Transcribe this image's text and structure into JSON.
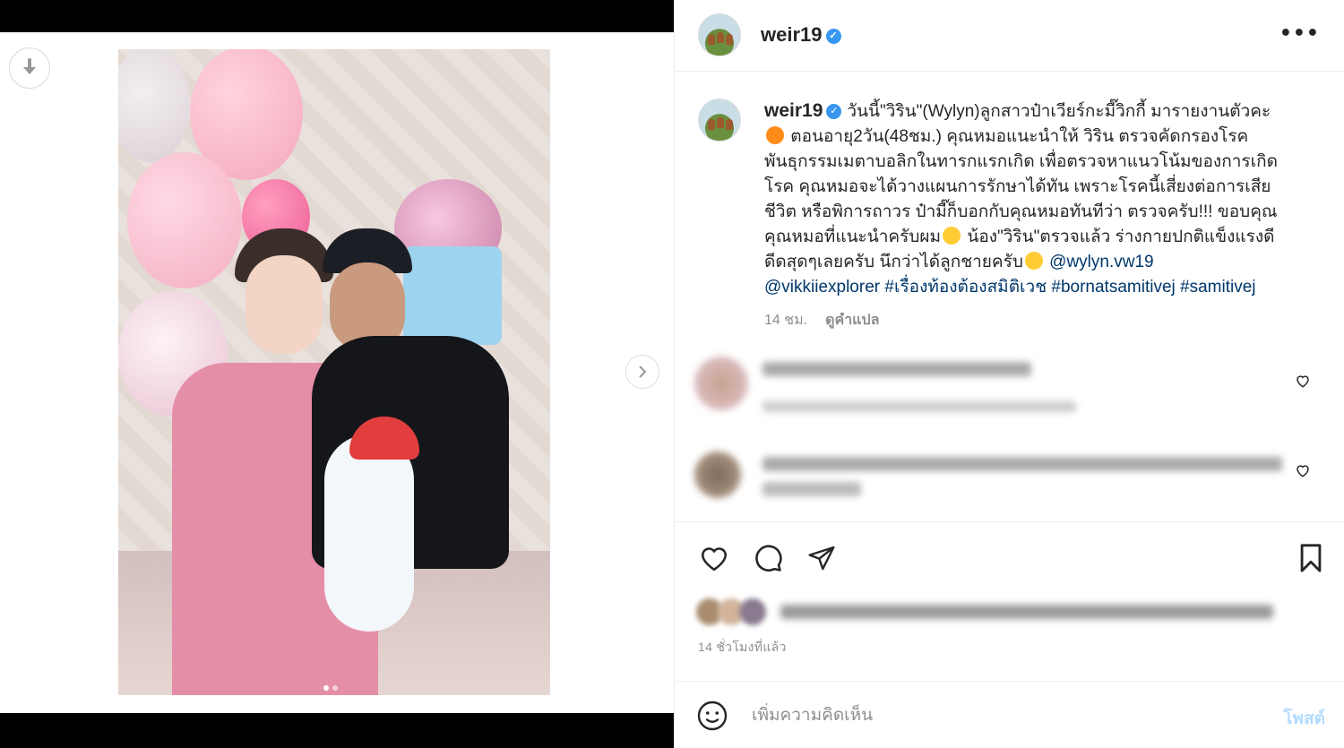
{
  "post": {
    "username": "weir19",
    "verified": true
  },
  "caption": {
    "username": "weir19",
    "lines": [
      "วันนี้\"วิริน\"(Wylyn)ลูกสาวป๋าเวียร์กะมี๊วิกกี้ มารายงานตัวคะ",
      "ตอนอายุ2วัน(48ชม.) คุณหมอแนะนำให้ วิริน ตรวจคัดกรองโรค",
      "พันธุกรรมเมตาบอลิกในทารกแรกเกิด เพื่อตรวจหาแนวโน้มของการเกิด",
      "โรค คุณหมอจะได้วางแผนการรักษาได้ทัน เพราะโรคนี้เสี่ยงต่อการเสีย",
      "ชีวิต หรือพิการถาวร ป๋ามี๊ก็บอกกับคุณหมอทันทีว่า ตรวจครับ!!! ขอบคุณ",
      "คุณหมอที่แนะนำครับผม",
      "น้อง\"วิริน\"ตรวจแล้ว ร่างกายปกติแข็งแรงดี",
      "ดีดสุดๆเลยครับ นึกว่าได้ลูกชายครับ"
    ],
    "mention1": "@wylyn.vw19",
    "mention2": "@vikkiiexplorer",
    "hashtag1": "#เรื่องท้องต้องสมิติเวช",
    "hashtag2": "#bornatsamitivej",
    "hashtag3": "#samitivej",
    "time": "14 ชม.",
    "translate": "ดูคำแปล"
  },
  "footer": {
    "time_ago": "14 ชั่วโมงที่แล้ว",
    "comment_placeholder": "เพิ่มความคิดเห็น",
    "post_label": "โพสต์"
  },
  "colors": {
    "verified": "#3897f0",
    "link": "#00376b",
    "post_disabled": "#b3dbff"
  },
  "icons": {
    "download": "download-arrow-icon",
    "next": "chevron-right-icon",
    "more": "more-options-icon",
    "like": "heart-icon",
    "comment": "comment-bubble-icon",
    "share": "paper-plane-icon",
    "save": "bookmark-icon",
    "emoji": "smile-icon"
  },
  "carousel": {
    "total": 2,
    "active": 1
  }
}
